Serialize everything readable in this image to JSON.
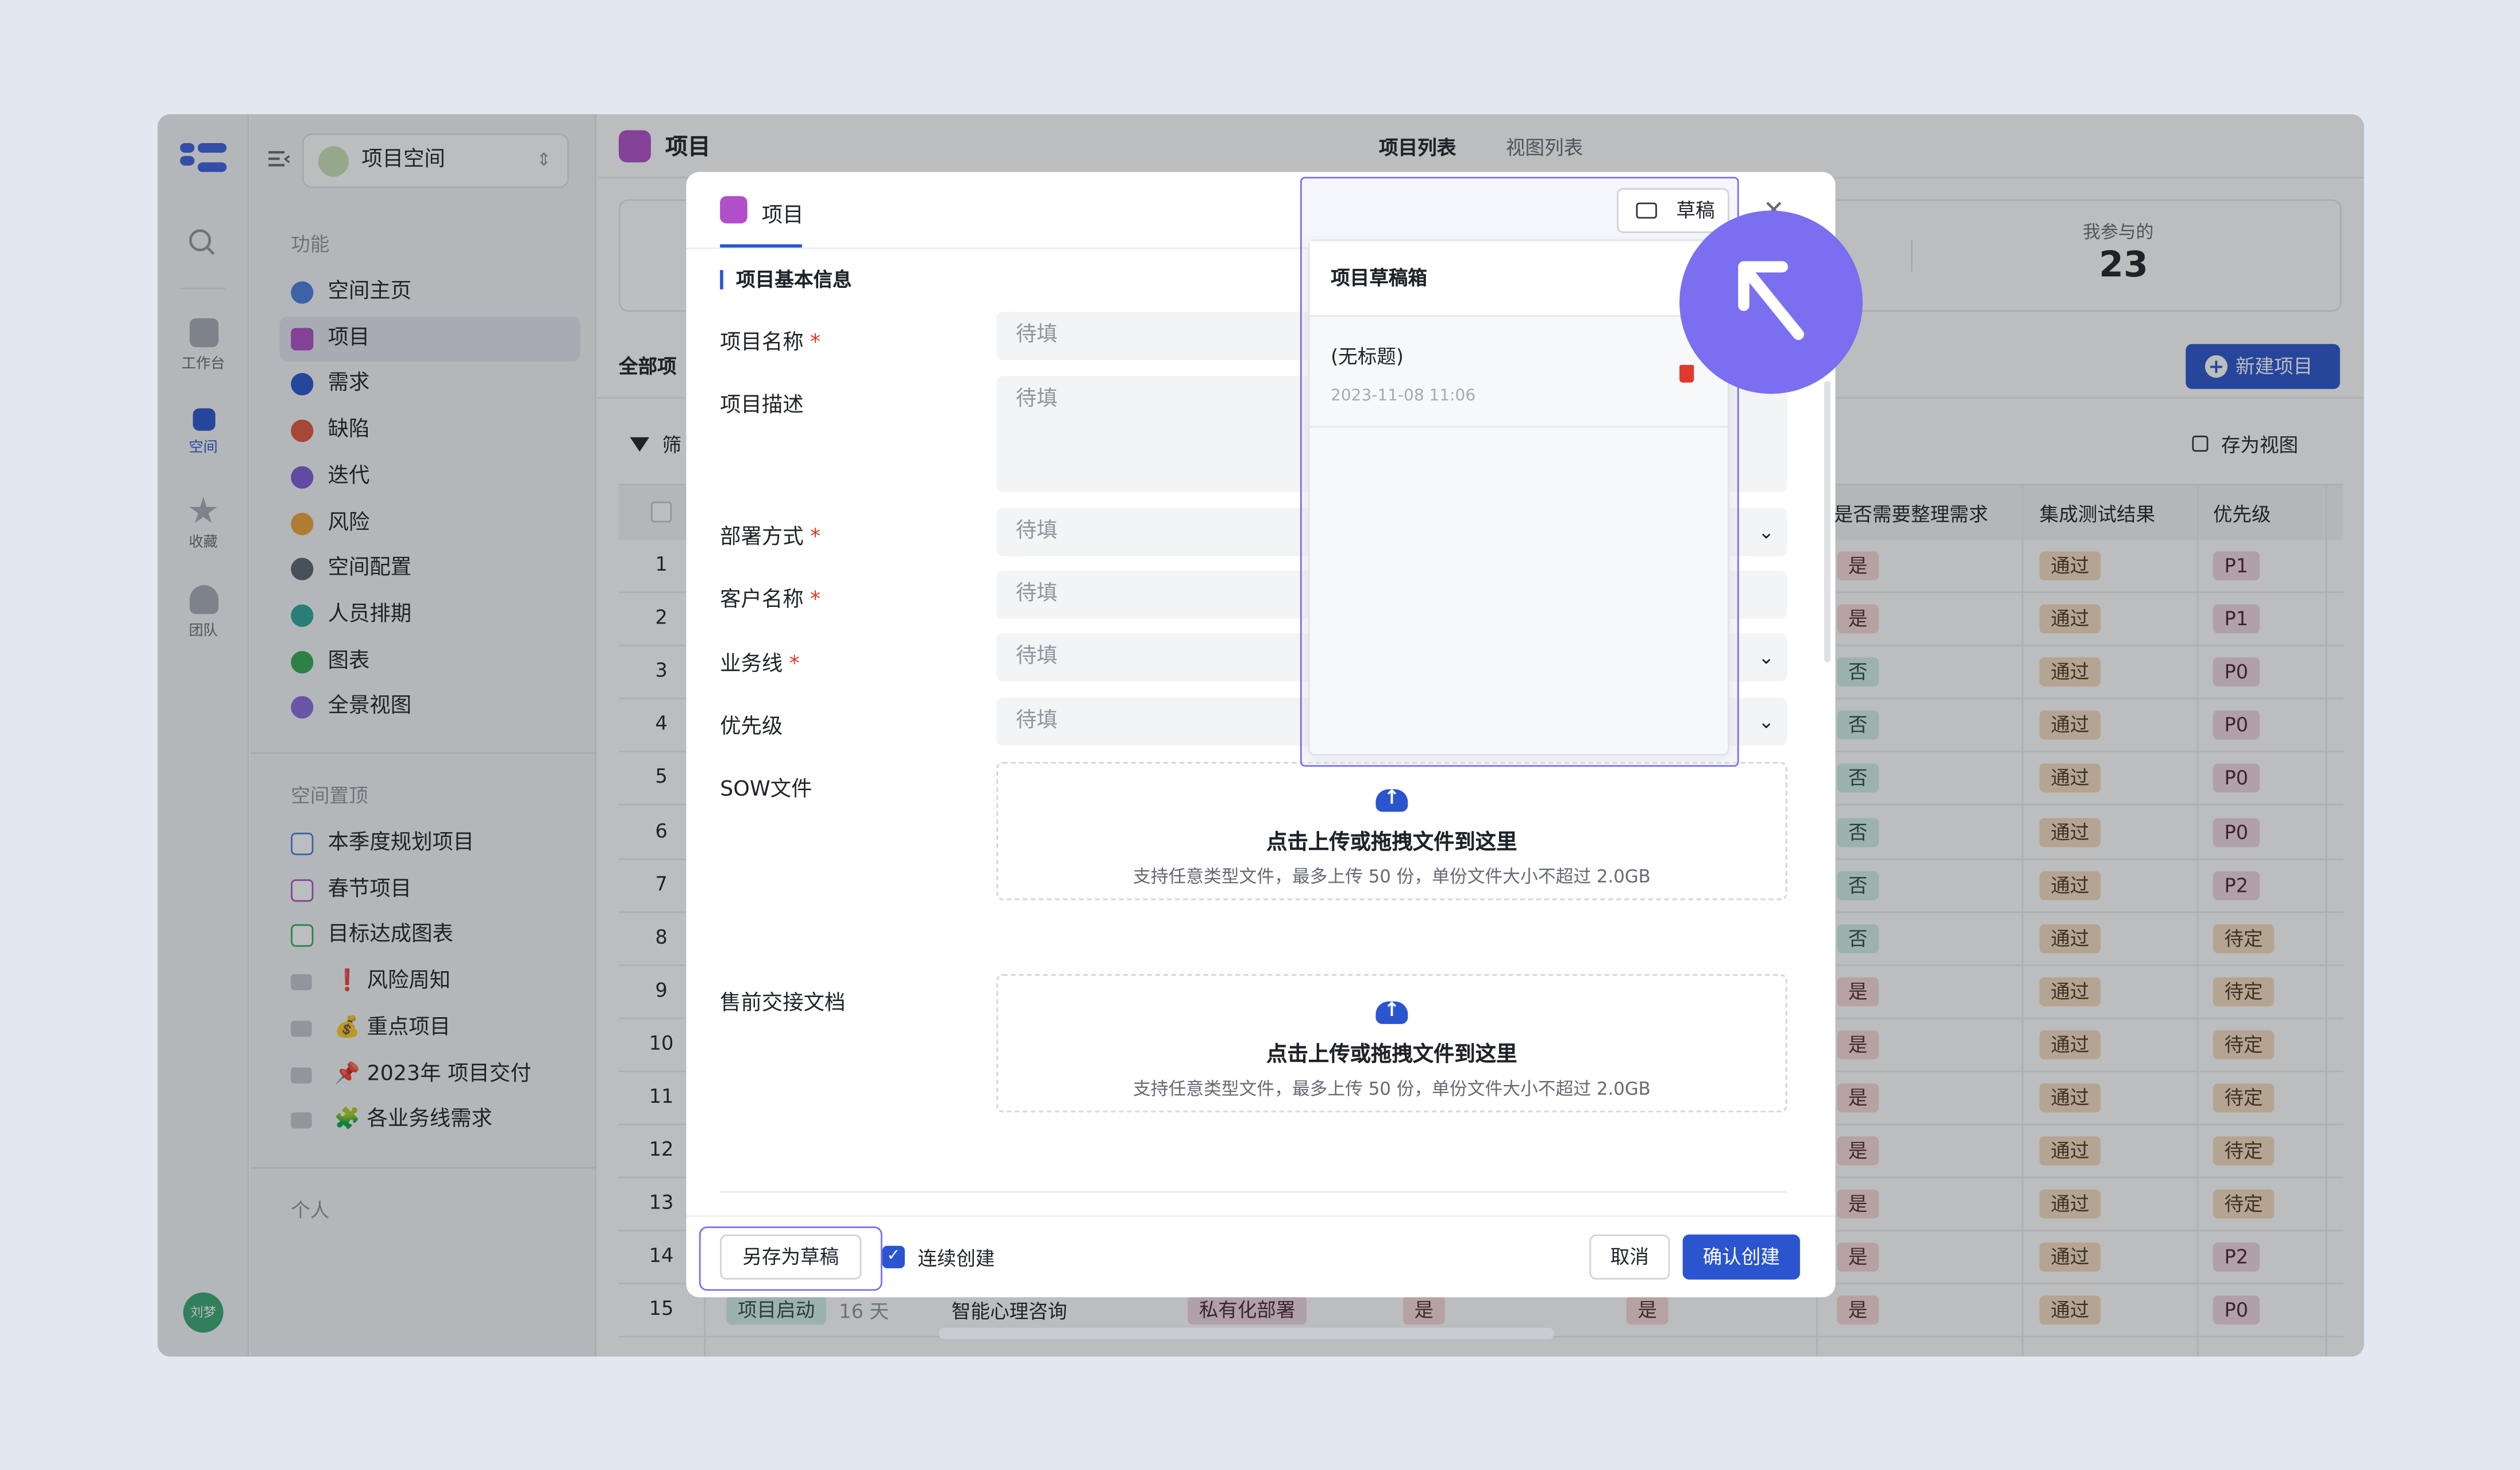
{
  "rail": {
    "items": [
      {
        "label": "工作台"
      },
      {
        "label": "空间"
      },
      {
        "label": "收藏"
      },
      {
        "label": "团队"
      }
    ],
    "avatar": "刘梦"
  },
  "sidebar": {
    "space_selector": "项目空间",
    "section_features": "功能",
    "features": [
      {
        "label": "空间主页",
        "color": "#4a7de0"
      },
      {
        "label": "项目",
        "color": "#b14ec9"
      },
      {
        "label": "需求",
        "color": "#2a55cf"
      },
      {
        "label": "缺陷",
        "color": "#e2563f"
      },
      {
        "label": "迭代",
        "color": "#7b5cd6"
      },
      {
        "label": "风险",
        "color": "#f0a23a"
      },
      {
        "label": "空间配置",
        "color": "#5c6370"
      },
      {
        "label": "人员排期",
        "color": "#2fa59b"
      },
      {
        "label": "图表",
        "color": "#34a853"
      },
      {
        "label": "全景视图",
        "color": "#8a6ae0"
      }
    ],
    "section_pinned": "空间置顶",
    "pinned": [
      {
        "label": "本季度规划项目"
      },
      {
        "label": "春节项目"
      },
      {
        "label": "目标达成图表"
      },
      {
        "label": "❗ 风险周知"
      },
      {
        "label": "💰 重点项目"
      },
      {
        "label": "📌 2023年 项目交付"
      },
      {
        "label": "🧩 各业务线需求"
      }
    ],
    "section_personal": "个人"
  },
  "main": {
    "title": "项目",
    "tabs": [
      "项目列表",
      "视图列表"
    ],
    "stat_label": "我参与的",
    "stat_value": "23",
    "all_tab": "全部项",
    "new_button": "新建项目",
    "filter_label": "筛",
    "save_view": "存为视图",
    "columns": [
      "是否需要整理需求",
      "集成测试结果",
      "优先级"
    ],
    "rows": [
      {
        "n": "1",
        "need": "是",
        "test": "通过",
        "pri": "P1"
      },
      {
        "n": "2",
        "need": "是",
        "test": "通过",
        "pri": "P1"
      },
      {
        "n": "3",
        "need": "否",
        "test": "通过",
        "pri": "P0"
      },
      {
        "n": "4",
        "need": "否",
        "test": "通过",
        "pri": "P0"
      },
      {
        "n": "5",
        "need": "否",
        "test": "通过",
        "pri": "P0"
      },
      {
        "n": "6",
        "need": "否",
        "test": "通过",
        "pri": "P0"
      },
      {
        "n": "7",
        "need": "否",
        "test": "通过",
        "pri": "P2"
      },
      {
        "n": "8",
        "need": "否",
        "test": "通过",
        "pri": "待定"
      },
      {
        "n": "9",
        "need": "是",
        "test": "通过",
        "pri": "待定"
      },
      {
        "n": "10",
        "need": "是",
        "test": "通过",
        "pri": "待定"
      },
      {
        "n": "11",
        "need": "是",
        "test": "通过",
        "pri": "待定"
      },
      {
        "n": "12",
        "need": "是",
        "test": "通过",
        "pri": "待定"
      },
      {
        "n": "13",
        "need": "是",
        "test": "通过",
        "pri": "待定"
      },
      {
        "n": "14",
        "need": "是",
        "test": "通过",
        "pri": "P2"
      },
      {
        "n": "15",
        "need": "是",
        "test": "通过",
        "pri": "P0"
      }
    ],
    "row15_extra": {
      "stage": "项目启动",
      "days": "16 天",
      "name": "智能心理咨询",
      "deploy": "私有化部署",
      "a": "是",
      "b": "是"
    }
  },
  "modal": {
    "tab": "项目",
    "section": "项目基本信息",
    "fields": [
      {
        "label": "项目名称",
        "placeholder": "待填"
      },
      {
        "label": "项目描述",
        "placeholder": "待填"
      },
      {
        "label": "部署方式",
        "placeholder": "待填"
      },
      {
        "label": "客户名称",
        "placeholder": "待填"
      },
      {
        "label": "业务线",
        "placeholder": "待填"
      },
      {
        "label": "优先级",
        "placeholder": "待填"
      }
    ],
    "upload_sow_label": "SOW文件",
    "upload_presale_label": "售前交接文档",
    "upload_title": "点击上传或拖拽文件到这里",
    "upload_hint": "支持任意类型文件，最多上传 50 份，单份文件大小不超过 2.0GB",
    "save_draft": "另存为草稿",
    "continue_create": "连续创建",
    "cancel": "取消",
    "confirm": "确认创建",
    "draft_button": "草稿"
  },
  "drafts": {
    "title": "项目草稿箱",
    "items": [
      {
        "title": "(无标题)",
        "date": "2023-11-08 11:06"
      }
    ]
  }
}
